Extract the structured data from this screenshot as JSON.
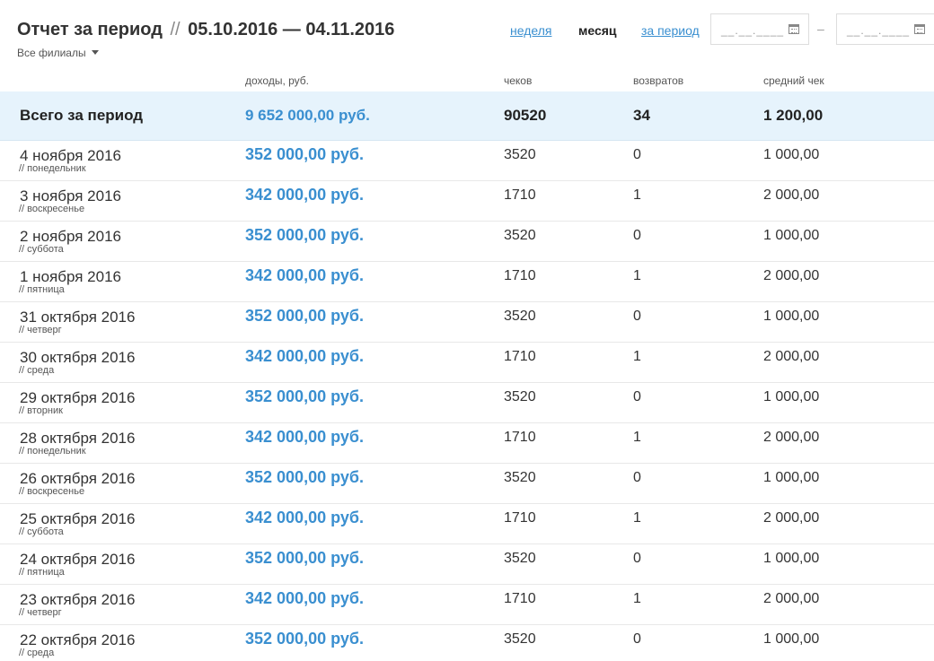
{
  "header": {
    "title": "Отчет за период",
    "separator": "//",
    "range": "05.10.2016 — 04.11.2016",
    "branch_filter": "Все филиалы",
    "nav": {
      "week": "неделя",
      "month": "месяц",
      "custom": "за период"
    },
    "date_from_mask": "__.__.____",
    "date_to_mask": "__.__.____",
    "date_dash": "–"
  },
  "columns": {
    "income": "доходы, руб.",
    "checks": "чеков",
    "returns": "возвратов",
    "avg": "средний чек"
  },
  "total": {
    "label": "Всего за период",
    "income": "9 652 000,00 руб.",
    "checks": "90520",
    "returns": "34",
    "avg": "1 200,00"
  },
  "rows": [
    {
      "date": "4 ноября 2016",
      "dow": "// понедельник",
      "income": "352 000,00 руб.",
      "checks": "3520",
      "returns": "0",
      "avg": "1 000,00"
    },
    {
      "date": "3 ноября 2016",
      "dow": "// воскресенье",
      "income": "342 000,00 руб.",
      "checks": "1710",
      "returns": "1",
      "avg": "2 000,00"
    },
    {
      "date": "2 ноября 2016",
      "dow": "// суббота",
      "income": "352 000,00 руб.",
      "checks": "3520",
      "returns": "0",
      "avg": "1 000,00"
    },
    {
      "date": "1 ноября 2016",
      "dow": "// пятница",
      "income": "342 000,00 руб.",
      "checks": "1710",
      "returns": "1",
      "avg": "2 000,00"
    },
    {
      "date": "31 октября 2016",
      "dow": "// четверг",
      "income": "352 000,00 руб.",
      "checks": "3520",
      "returns": "0",
      "avg": "1 000,00"
    },
    {
      "date": "30 октября 2016",
      "dow": "// среда",
      "income": "342 000,00 руб.",
      "checks": "1710",
      "returns": "1",
      "avg": "2 000,00"
    },
    {
      "date": "29 октября 2016",
      "dow": "// вторник",
      "income": "352 000,00 руб.",
      "checks": "3520",
      "returns": "0",
      "avg": "1 000,00"
    },
    {
      "date": "28 октября 2016",
      "dow": "// понедельник",
      "income": "342 000,00 руб.",
      "checks": "1710",
      "returns": "1",
      "avg": "2 000,00"
    },
    {
      "date": "26 октября 2016",
      "dow": "// воскресенье",
      "income": "352 000,00 руб.",
      "checks": "3520",
      "returns": "0",
      "avg": "1 000,00"
    },
    {
      "date": "25 октября 2016",
      "dow": "// суббота",
      "income": "342 000,00 руб.",
      "checks": "1710",
      "returns": "1",
      "avg": "2 000,00"
    },
    {
      "date": "24 октября 2016",
      "dow": "// пятница",
      "income": "352 000,00 руб.",
      "checks": "3520",
      "returns": "0",
      "avg": "1 000,00"
    },
    {
      "date": "23 октября 2016",
      "dow": "// четверг",
      "income": "342 000,00 руб.",
      "checks": "1710",
      "returns": "1",
      "avg": "2 000,00"
    },
    {
      "date": "22 октября 2016",
      "dow": "// среда",
      "income": "352 000,00 руб.",
      "checks": "3520",
      "returns": "0",
      "avg": "1 000,00"
    }
  ],
  "colors": {
    "accent": "#3a8fd0",
    "total_bg": "#e6f3fc",
    "text": "#222222"
  },
  "icons": {
    "calendar": "calendar-icon",
    "caret": "chevron-down-icon"
  }
}
